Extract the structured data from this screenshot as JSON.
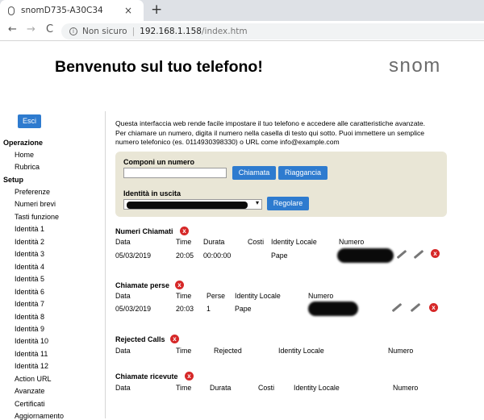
{
  "browser": {
    "tab_title": "snomD735-A30C34",
    "tab_close": "×",
    "new_tab": "+",
    "back": "←",
    "forward": "→",
    "reload": "C",
    "security": "Non sicuro",
    "url_host": "192.168.1.158",
    "url_path": "/index.htm"
  },
  "page": {
    "title": "Benvenuto sul tuo telefono!",
    "logo": "snom"
  },
  "sidebar": {
    "logout": "Esci",
    "section_operazione": "Operazione",
    "operazione_items": [
      "Home",
      "Rubrica"
    ],
    "section_setup": "Setup",
    "setup_items": [
      "Preferenze",
      "Numeri brevi",
      "Tasti funzione",
      "Identità 1",
      "Identità 2",
      "Identità 3",
      "Identità 4",
      "Identità 5",
      "Identità 6",
      "Identità 7",
      "Identità 8",
      "Identità 9",
      "Identità 10",
      "Identità 11",
      "Identità 12",
      "Action URL",
      "Avanzate",
      "Certificati",
      "Aggiornamento"
    ]
  },
  "main": {
    "intro_1": "Questa interfaccia web rende facile impostare il tuo telefono e accedere alle caratteristiche avanzate.",
    "intro_2": "Per chiamare un numero, digita il numero nella casella di testo qui sotto. Puoi immettere un semplice",
    "intro_3": "numero telefonico (es. 0114930398330) o URL come info@example.com",
    "dial_label": "Componi un numero",
    "dial_value": "",
    "call_button": "Chiamata",
    "hangup_button": "Riaggancia",
    "identity_label": "Identità in uscita",
    "adjust_button": "Regolare",
    "dialed": {
      "title": "Numeri Chiamati",
      "headers": [
        "Data",
        "Time",
        "Durata",
        "Costi",
        "Identity Locale",
        "Numero"
      ],
      "row": [
        "05/03/2019",
        "20:05",
        "00:00:00",
        "",
        "Pape"
      ]
    },
    "missed": {
      "title": "Chiamate perse",
      "headers": [
        "Data",
        "Time",
        "Perse",
        "Identity Locale",
        "Numero"
      ],
      "row": [
        "05/03/2019",
        "20:03",
        "1",
        "Pape"
      ]
    },
    "rejected": {
      "title": "Rejected Calls",
      "headers": [
        "Data",
        "Time",
        "Rejected",
        "Identity Locale",
        "Numero"
      ]
    },
    "received": {
      "title": "Chiamate ricevute",
      "headers": [
        "Data",
        "Time",
        "Durata",
        "Costi",
        "Identity Locale",
        "Numero"
      ]
    },
    "delete_icon_glyph": "x"
  },
  "colors": {
    "button_blue": "#2e7bcf",
    "dial_panel": "#e9e6d6",
    "delete_red": "#d62828",
    "logo_gray": "#6b6b6b"
  }
}
